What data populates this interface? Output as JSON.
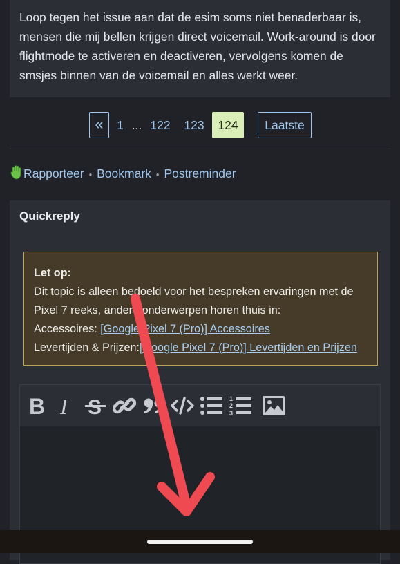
{
  "post": {
    "text": "Loop tegen het issue aan dat de esim soms niet benaderbaar is, mensen die mij bellen krijgen direct voicemail. Work-around is door flightmode te activeren en deactiveren, vervolgens komen de smsjes binnen van de voicemail en alles werkt weer."
  },
  "pagination": {
    "prev": "«",
    "first": "1",
    "ellipsis": "...",
    "p122": "122",
    "p123": "123",
    "current": "124",
    "last": "Laatste",
    "colors": {
      "link": "#9fc6ee",
      "current_bg": "#d9efb7"
    }
  },
  "actions": {
    "report": "Rapporteer",
    "separator": "•",
    "bookmark": "Bookmark",
    "postreminder": "Postreminder"
  },
  "quickreply": {
    "title": "Quickreply",
    "notice": {
      "heading": "Let op:",
      "line1": "Dit topic is alleen bedoeld voor het bespreken ervaringen met de Pixel 7 reeks, andere onderwerpen horen thuis in:",
      "accessoires_label": "Accessoires:",
      "accessoires_link": "[Google Pixel 7 (Pro)] Accessoires",
      "levertijden_label": "Levertijden & Prijzen:",
      "levertijden_link": "[Google Pixel 7 (Pro)] Levertijden en Prijzen"
    },
    "toolbar": [
      "bold-icon",
      "italic-icon",
      "strikethrough-icon",
      "link-icon",
      "quote-icon",
      "code-icon",
      "bullet-list-icon",
      "numbered-list-icon",
      "image-icon"
    ]
  },
  "colors": {
    "page_bg": "#202227",
    "panel_bg": "#2b2e34",
    "notice_bg": "#463b29",
    "notice_border": "#c0a155",
    "arrow": "#ef4a52"
  }
}
